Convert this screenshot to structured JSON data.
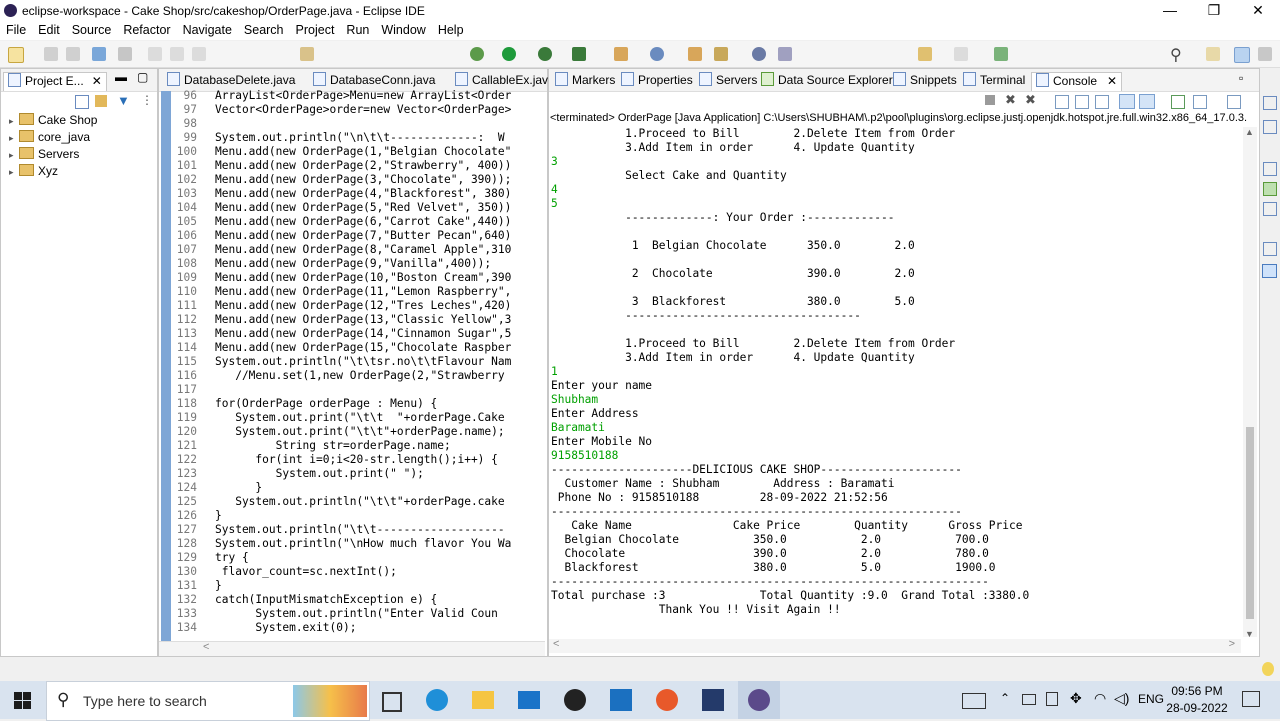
{
  "window": {
    "title": "eclipse-workspace - Cake Shop/src/cakeshop/OrderPage.java - Eclipse IDE",
    "minimize": "—",
    "maximize": "❐",
    "close": "✕"
  },
  "menu": [
    "File",
    "Edit",
    "Source",
    "Refactor",
    "Navigate",
    "Search",
    "Project",
    "Run",
    "Window",
    "Help"
  ],
  "project_explorer": {
    "tab_label": "Project E...",
    "items": [
      "Cake Shop",
      "core_java",
      "Servers",
      "Xyz"
    ]
  },
  "editor": {
    "tabs": [
      "DatabaseDelete.java",
      "DatabaseConn.java",
      "CallableEx.java"
    ],
    "lines": [
      {
        "n": "96",
        "t": "ArrayList<OrderPage>Menu=new ArrayList<Order"
      },
      {
        "n": "97",
        "t": "Vector<OrderPage>order=new Vector<OrderPage>"
      },
      {
        "n": "98",
        "t": ""
      },
      {
        "n": "99",
        "t": "System.out.println(\"\\n\\t\\t-------------:  W"
      },
      {
        "n": "100",
        "t": "Menu.add(new OrderPage(1,\"Belgian Chocolate\""
      },
      {
        "n": "101",
        "t": "Menu.add(new OrderPage(2,\"Strawberry\", 400))"
      },
      {
        "n": "102",
        "t": "Menu.add(new OrderPage(3,\"Chocolate\", 390));"
      },
      {
        "n": "103",
        "t": "Menu.add(new OrderPage(4,\"Blackforest\", 380)"
      },
      {
        "n": "104",
        "t": "Menu.add(new OrderPage(5,\"Red Velvet\", 350))"
      },
      {
        "n": "105",
        "t": "Menu.add(new OrderPage(6,\"Carrot Cake\",440))"
      },
      {
        "n": "106",
        "t": "Menu.add(new OrderPage(7,\"Butter Pecan\",640)"
      },
      {
        "n": "107",
        "t": "Menu.add(new OrderPage(8,\"Caramel Apple\",310"
      },
      {
        "n": "108",
        "t": "Menu.add(new OrderPage(9,\"Vanilla\",400));"
      },
      {
        "n": "109",
        "t": "Menu.add(new OrderPage(10,\"Boston Cream\",390"
      },
      {
        "n": "110",
        "t": "Menu.add(new OrderPage(11,\"Lemon Raspberry\","
      },
      {
        "n": "111",
        "t": "Menu.add(new OrderPage(12,\"Tres Leches\",420)"
      },
      {
        "n": "112",
        "t": "Menu.add(new OrderPage(13,\"Classic Yellow\",3"
      },
      {
        "n": "113",
        "t": "Menu.add(new OrderPage(14,\"Cinnamon Sugar\",5"
      },
      {
        "n": "114",
        "t": "Menu.add(new OrderPage(15,\"Chocolate Raspber"
      },
      {
        "n": "115",
        "t": "System.out.println(\"\\t\\tsr.no\\t\\tFlavour Nam"
      },
      {
        "n": "116",
        "t": "   //Menu.set(1,new OrderPage(2,\"Strawberry"
      },
      {
        "n": "117",
        "t": ""
      },
      {
        "n": "118",
        "t": "for(OrderPage orderPage : Menu) {"
      },
      {
        "n": "119",
        "t": "   System.out.print(\"\\t\\t  \"+orderPage.Cake"
      },
      {
        "n": "120",
        "t": "   System.out.print(\"\\t\\t\"+orderPage.name);"
      },
      {
        "n": "121",
        "t": "         String str=orderPage.name;"
      },
      {
        "n": "122",
        "t": "      for(int i=0;i<20-str.length();i++) {"
      },
      {
        "n": "123",
        "t": "         System.out.print(\" \");"
      },
      {
        "n": "124",
        "t": "      }"
      },
      {
        "n": "125",
        "t": "   System.out.println(\"\\t\\t\"+orderPage.cake"
      },
      {
        "n": "126",
        "t": "}"
      },
      {
        "n": "127",
        "t": "System.out.println(\"\\t\\t-------------------"
      },
      {
        "n": "128",
        "t": "System.out.println(\"\\nHow much flavor You Wa"
      },
      {
        "n": "129",
        "t": "try {"
      },
      {
        "n": "130",
        "t": " flavor_count=sc.nextInt();"
      },
      {
        "n": "131",
        "t": "}"
      },
      {
        "n": "132",
        "t": "catch(InputMismatchException e) {"
      },
      {
        "n": "133",
        "t": "      System.out.println(\"Enter Valid Coun"
      },
      {
        "n": "134",
        "t": "      System.exit(0);"
      }
    ]
  },
  "console_view": {
    "tabs": [
      "Markers",
      "Properties",
      "Servers",
      "Data Source Explorer",
      "Snippets",
      "Terminal",
      "Console"
    ],
    "header": "<terminated> OrderPage [Java Application] C:\\Users\\SHUBHAM\\.p2\\pool\\plugins\\org.eclipse.justj.openjdk.hotspot.jre.full.win32.x86_64_17.0.3.",
    "lines": [
      {
        "t": "           1.Proceed to Bill        2.Delete Item from Order",
        "in": false
      },
      {
        "t": "           3.Add Item in order      4. Update Quantity",
        "in": false
      },
      {
        "t": "3",
        "in": true
      },
      {
        "t": "           Select Cake and Quantity",
        "in": false
      },
      {
        "t": "4",
        "in": true
      },
      {
        "t": "5",
        "in": true
      },
      {
        "t": "           -------------: Your Order :-------------",
        "in": false
      },
      {
        "t": "",
        "in": false
      },
      {
        "t": "            1  Belgian Chocolate      350.0        2.0",
        "in": false
      },
      {
        "t": "",
        "in": false
      },
      {
        "t": "            2  Chocolate              390.0        2.0",
        "in": false
      },
      {
        "t": "",
        "in": false
      },
      {
        "t": "            3  Blackforest            380.0        5.0",
        "in": false
      },
      {
        "t": "           -----------------------------------",
        "in": false
      },
      {
        "t": "",
        "in": false
      },
      {
        "t": "           1.Proceed to Bill        2.Delete Item from Order",
        "in": false
      },
      {
        "t": "           3.Add Item in order      4. Update Quantity",
        "in": false
      },
      {
        "t": "1",
        "in": true
      },
      {
        "t": "Enter your name",
        "in": false
      },
      {
        "t": "Shubham",
        "in": true
      },
      {
        "t": "Enter Address",
        "in": false
      },
      {
        "t": "Baramati",
        "in": true
      },
      {
        "t": "Enter Mobile No",
        "in": false
      },
      {
        "t": "9158510188",
        "in": true
      },
      {
        "t": "---------------------DELICIOUS CAKE SHOP---------------------",
        "in": false
      },
      {
        "t": "  Customer Name : Shubham        Address : Baramati",
        "in": false
      },
      {
        "t": " Phone No : 9158510188         28-09-2022 21:52:56",
        "in": false
      },
      {
        "t": "-------------------------------------------------------------",
        "in": false
      },
      {
        "t": "   Cake Name               Cake Price        Quantity      Gross Price",
        "in": false
      },
      {
        "t": "  Belgian Chocolate           350.0           2.0           700.0",
        "in": false
      },
      {
        "t": "  Chocolate                   390.0           2.0           780.0",
        "in": false
      },
      {
        "t": "  Blackforest                 380.0           5.0           1900.0",
        "in": false
      },
      {
        "t": "-----------------------------------------------------------------",
        "in": false
      },
      {
        "t": "Total purchase :3              Total Quantity :9.0  Grand Total :3380.0",
        "in": false
      },
      {
        "t": "                Thank You !! Visit Again !!",
        "in": false
      }
    ]
  },
  "taskbar": {
    "search_placeholder": "Type here to search",
    "lang": "ENG",
    "time": "09:56 PM",
    "date": "28-09-2022"
  }
}
